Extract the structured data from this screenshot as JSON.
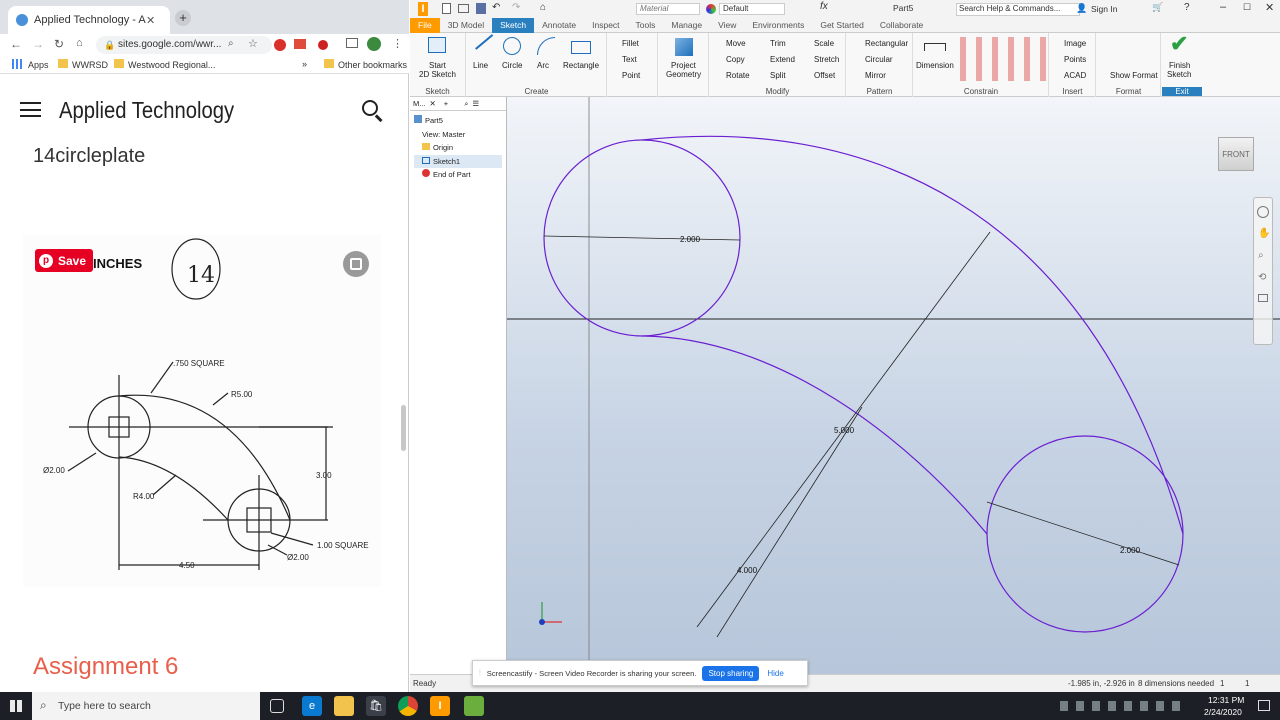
{
  "chrome": {
    "tab_title": "Applied Technology - AutoDesk",
    "new_tab": "+",
    "url": "sites.google.com/wwr...",
    "bookmarks": [
      "Apps",
      "WWRSD",
      "Westwood Regional...",
      "Other bookmarks"
    ],
    "overflow": "»"
  },
  "site": {
    "title": "Applied Technology",
    "page_heading": "14circleplate",
    "save_label": "Save",
    "inches_label": "INCHES",
    "next_heading": "Assignment 6"
  },
  "drawing": {
    "square_750": ".750 SQUARE",
    "r5": "R5.00",
    "d2_left": "Ø2.00",
    "dim_3": "3.00",
    "r4": "R4.00",
    "dim_450": "4.50",
    "sq_100": "1.00 SQUARE",
    "d2_right": "Ø2.00",
    "handwritten": "14"
  },
  "inventor": {
    "title": "Part5",
    "material": "Material",
    "appearance": "Default",
    "search_placeholder": "Search Help & Commands...",
    "sign_in": "Sign In",
    "tabs": [
      "File",
      "3D Model",
      "Sketch",
      "Annotate",
      "Inspect",
      "Tools",
      "Manage",
      "View",
      "Environments",
      "Get Started",
      "Collaborate"
    ],
    "active_tab": "Sketch",
    "ribbon": {
      "sketch": {
        "start_label": "Start",
        "start_label2": "2D Sketch",
        "group": "Sketch"
      },
      "create": {
        "line": "Line",
        "circle": "Circle",
        "arc": "Arc",
        "rectangle": "Rectangle",
        "fillet": "Fillet",
        "text": "Text",
        "point": "Point",
        "group": "Create"
      },
      "project": {
        "label": "Project",
        "label2": "Geometry"
      },
      "modify": {
        "move": "Move",
        "copy": "Copy",
        "rotate": "Rotate",
        "trim": "Trim",
        "extend": "Extend",
        "split": "Split",
        "scale": "Scale",
        "stretch": "Stretch",
        "offset": "Offset",
        "group": "Modify"
      },
      "pattern": {
        "rectangular": "Rectangular",
        "circular": "Circular",
        "mirror": "Mirror",
        "group": "Pattern"
      },
      "constrain": {
        "dimension": "Dimension",
        "group": "Constrain"
      },
      "insert": {
        "image": "Image",
        "points": "Points",
        "acad": "ACAD",
        "group": "Insert"
      },
      "format": {
        "show_format": "Show Format",
        "group": "Format"
      },
      "exit": {
        "finish": "Finish",
        "finish2": "Sketch",
        "group": "Exit"
      }
    },
    "browser": {
      "tab": "M...",
      "items": [
        "Part5",
        "View: Master",
        "Origin",
        "Sketch1",
        "End of Part"
      ]
    },
    "viewcube": "FRONT",
    "dims": {
      "top_circle": "2.000",
      "long": "5.000",
      "inner": "4.000",
      "bottom_circle": "2.000"
    },
    "status": {
      "ready": "Ready",
      "coords": "-1.985 in, -2.926 in",
      "dims_needed": "8 dimensions needed",
      "n1": "1",
      "n2": "1"
    },
    "share": {
      "message": "Screencastify - Screen Video Recorder is sharing your screen.",
      "stop": "Stop sharing",
      "hide": "Hide"
    }
  },
  "taskbar": {
    "search": "Type here to search",
    "time": "12:31 PM",
    "date": "2/24/2020"
  },
  "colors": {
    "accent": "#2a7fbf",
    "sketch": "#6a1fd0",
    "file_tab": "#ff9b00",
    "assignment": "#e8604c"
  }
}
